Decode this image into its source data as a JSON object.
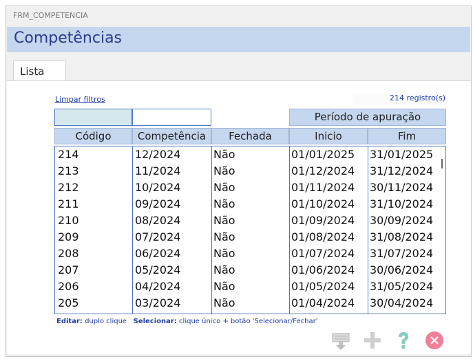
{
  "window": {
    "title": "FRM_COMPETENCIA"
  },
  "header": {
    "title": "Competências"
  },
  "tabs": [
    {
      "label": "Lista"
    }
  ],
  "filters": {
    "clear_label": "Limpar filtros",
    "record_count": "214 registro(s)",
    "code_value": "",
    "competence_value": ""
  },
  "period_header": "Período de apuração",
  "columns": [
    "Código",
    "Competência",
    "Fechada",
    "Inicio",
    "Fim"
  ],
  "rows": [
    [
      "214",
      "12/2024",
      "Não",
      "01/01/2025",
      "31/01/2025"
    ],
    [
      "213",
      "11/2024",
      "Não",
      "01/12/2024",
      "31/12/2024"
    ],
    [
      "212",
      "10/2024",
      "Não",
      "01/11/2024",
      "30/11/2024"
    ],
    [
      "211",
      "09/2024",
      "Não",
      "01/10/2024",
      "31/10/2024"
    ],
    [
      "210",
      "08/2024",
      "Não",
      "01/09/2024",
      "30/09/2024"
    ],
    [
      "209",
      "07/2024",
      "Não",
      "01/08/2024",
      "31/08/2024"
    ],
    [
      "208",
      "06/2024",
      "Não",
      "01/07/2024",
      "31/07/2024"
    ],
    [
      "207",
      "05/2024",
      "Não",
      "01/06/2024",
      "30/06/2024"
    ],
    [
      "206",
      "04/2024",
      "Não",
      "01/05/2024",
      "31/05/2024"
    ],
    [
      "205",
      "03/2024",
      "Não",
      "01/04/2024",
      "30/04/2024"
    ]
  ],
  "hint": {
    "edit_label": "Editar:",
    "edit_text": "duplo clique",
    "select_label": "Selecionar:",
    "select_text": "clique único + botão 'Selecionar/Fechar'"
  },
  "toolbar": {
    "buttons": [
      {
        "icon": "select-close-icon"
      },
      {
        "icon": "add-icon"
      },
      {
        "icon": "help-icon"
      },
      {
        "icon": "close-icon"
      }
    ]
  },
  "colors": {
    "accent": "#c5d7ee",
    "title": "#2a3a8c",
    "link": "#1f3ea8",
    "border": "#4e78c0"
  }
}
